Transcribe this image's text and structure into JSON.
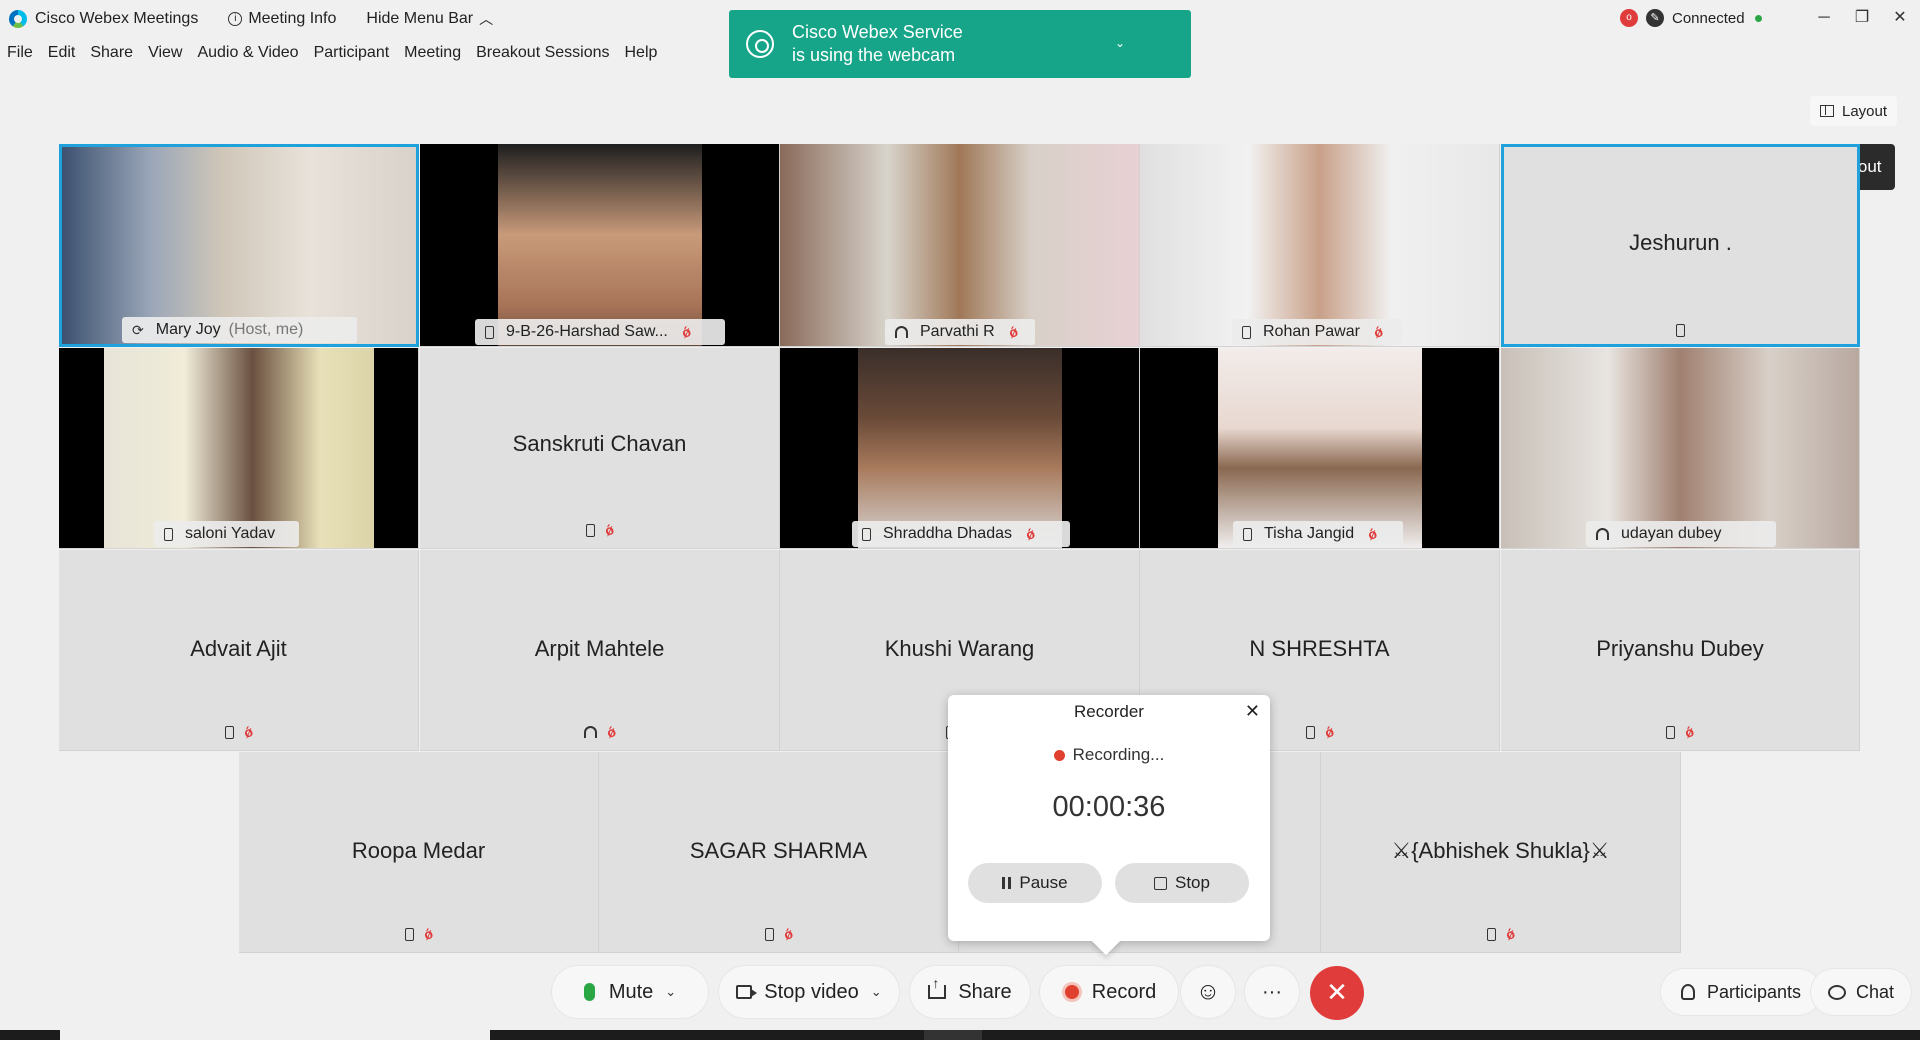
{
  "titlebar": {
    "app_name": "Cisco Webex Meetings",
    "meeting_info": "Meeting Info",
    "hide_menu": "Hide Menu Bar",
    "status": "Connected",
    "record_badge": "o"
  },
  "menu": [
    "File",
    "Edit",
    "Share",
    "View",
    "Audio & Video",
    "Participant",
    "Meeting",
    "Breakout Sessions",
    "Help"
  ],
  "notification": {
    "line1": "Cisco Webex Service",
    "line2": "is using the webcam"
  },
  "layout_button": "Layout",
  "tooltip": "Layout",
  "participants": {
    "mary": {
      "name": "Mary Joy",
      "tag": "(Host, me)"
    },
    "harshad": {
      "name": "9-B-26-Harshad Saw..."
    },
    "parvathi": {
      "name": "Parvathi R"
    },
    "rohan": {
      "name": "Rohan Pawar"
    },
    "jeshurun": {
      "name": "Jeshurun ."
    },
    "saloni": {
      "name": "saloni Yadav"
    },
    "sanskruti": {
      "name": "Sanskruti Chavan"
    },
    "shraddha": {
      "name": "Shraddha Dhadas"
    },
    "tisha": {
      "name": "Tisha Jangid"
    },
    "udayan": {
      "name": "udayan dubey"
    },
    "advait": {
      "name": "Advait Ajit"
    },
    "arpit": {
      "name": "Arpit Mahtele"
    },
    "khushi": {
      "name": "Khushi Warang"
    },
    "shreshta": {
      "name": "N SHRESHTA"
    },
    "priyanshu": {
      "name": "Priyanshu Dubey"
    },
    "roopa": {
      "name": "Roopa Medar"
    },
    "sagar": {
      "name": "SAGAR SHARMA"
    },
    "abhishek": {
      "name": "⚔{Abhishek Shukla}⚔"
    }
  },
  "recorder": {
    "title": "Recorder",
    "status": "Recording...",
    "elapsed": "00:00:36",
    "pause": "Pause",
    "stop": "Stop"
  },
  "controls": {
    "mute": "Mute",
    "stop_video": "Stop video",
    "share": "Share",
    "record": "Record",
    "more": "···",
    "end": "✕",
    "participants": "Participants",
    "chat": "Chat"
  },
  "colors": {
    "accent": "#1fa2dc",
    "notification": "#17a589",
    "end_call": "#e03c3c",
    "connected": "#2aa745"
  }
}
